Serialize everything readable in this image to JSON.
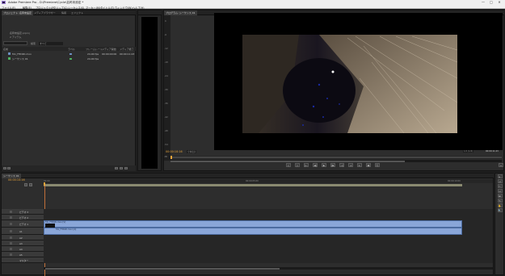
{
  "window": {
    "title": "Adobe Premiere Pro - D:\\Premiere\\Cycle\\名称未設定 *",
    "minimize": "—",
    "maximize": "□",
    "close": "✕"
  },
  "menu": [
    "ファイル(F)",
    "編集(E)",
    "プロジェクト(P)",
    "クリップ(C)",
    "シーケンス(S)",
    "マーカー(M)",
    "タイトル(T)",
    "ウィンドウ(W)",
    "ヘルプ(H)"
  ],
  "project_panel": {
    "tabs": [
      "プロジェクト: 名称未設定",
      "メディアブラウザー",
      "情報",
      "エフェクト"
    ],
    "project_name": "名称未設定.prproj",
    "item_count": "2 アイテム",
    "search_label": "検索",
    "search_value": "すべて",
    "columns": [
      "名前",
      "ラベル",
      "フレームレート",
      "メディア開始",
      "メディア終了"
    ],
    "rows": [
      {
        "name": "fdx_FHD2K.mov",
        "fps": "24.00 fps",
        "start": "00:00:00:00",
        "end": "00:00:11:23"
      },
      {
        "name": "シーケンス 01",
        "fps": "24.00 fps",
        "start": "",
        "end": ""
      }
    ]
  },
  "audio_meter": {
    "labels": [
      "0",
      "-6",
      "-12",
      "-18",
      "-24",
      "-30",
      "-36",
      "-42",
      "-48",
      "-54",
      "dB"
    ]
  },
  "program_monitor": {
    "tabs": [
      "プログラム: シーケンス 01"
    ],
    "timecode_left": "00:00:10:16",
    "fit": "全体表示",
    "timecode_right": "00:00:11:23",
    "buttons": [
      "{",
      "}",
      "|←",
      "◀|",
      "▶",
      "|▶",
      "→|",
      "⇥",
      "⇤",
      "▣",
      "⎘",
      "+"
    ],
    "scale": "1/2 (1/4)"
  },
  "timeline": {
    "tab": "シーケンス 01",
    "timecode": "00:00:10:16",
    "time_labels": [
      "00:00",
      "00:00:05:00",
      "00:00:10:00"
    ],
    "tracks": [
      {
        "name": "ビデオ 3",
        "type": "video"
      },
      {
        "name": "ビデオ 2",
        "type": "video"
      },
      {
        "name": "ビデオ 1",
        "type": "video",
        "clip": "fdx_FHD2K.mov [V]"
      },
      {
        "name": "A1",
        "type": "audio",
        "clip": "fdx_FHD2K.mov [A]"
      },
      {
        "name": "A2",
        "type": "audio"
      },
      {
        "name": "A3",
        "type": "audio"
      },
      {
        "name": "A4",
        "type": "audio"
      },
      {
        "name": "A5",
        "type": "audio"
      },
      {
        "name": "マスター",
        "type": "master"
      }
    ]
  },
  "tools": [
    "▸",
    "⇥",
    "✂",
    "↔",
    "⊞",
    "✎",
    "✋",
    "🔍"
  ],
  "colors": {
    "accent_timecode": "#e8a43a",
    "clip": "#8aa6d8",
    "panel": "#2d2d2d"
  }
}
